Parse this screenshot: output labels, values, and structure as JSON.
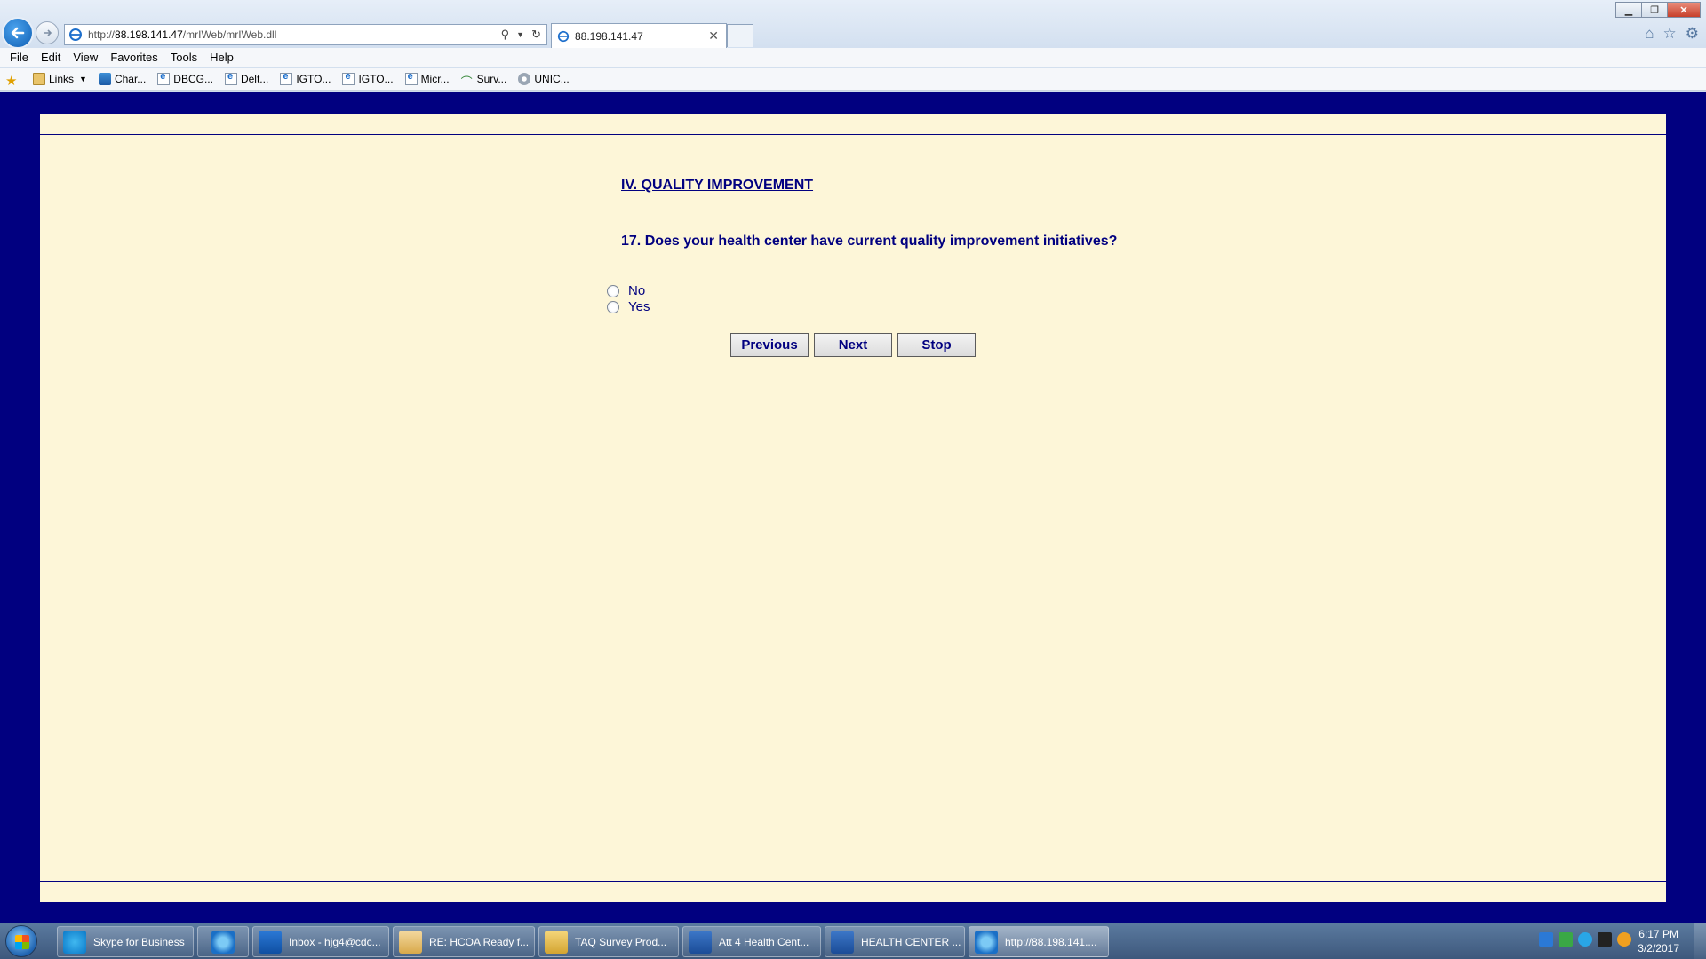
{
  "browser": {
    "address_prefix": "http://",
    "address_host": "88.198.141.47",
    "address_path": "/mrIWeb/mrIWeb.dll",
    "tab_title": "88.198.141.47"
  },
  "menu": [
    "File",
    "Edit",
    "View",
    "Favorites",
    "Tools",
    "Help"
  ],
  "favorites": {
    "links_label": "Links",
    "items": [
      "Char...",
      "DBCG...",
      "Delt...",
      "IGTO...",
      "IGTO...",
      "Micr...",
      "Surv...",
      "UNIC..."
    ]
  },
  "survey": {
    "section_title": "IV. QUALITY IMPROVEMENT",
    "question": "17. Does your health center have current quality improvement initiatives?",
    "options": [
      "No",
      "Yes"
    ],
    "buttons": {
      "previous": "Previous",
      "next": "Next",
      "stop": "Stop"
    }
  },
  "taskbar": {
    "items": [
      "Skype for Business",
      "",
      "Inbox - hjg4@cdc...",
      "RE: HCOA Ready f...",
      "TAQ Survey Prod...",
      "Att 4 Health Cent...",
      "HEALTH CENTER ...",
      "http://88.198.141...."
    ],
    "clock_time": "6:17 PM",
    "clock_date": "3/2/2017"
  },
  "colors": {
    "page_background": "#010080",
    "panel_background": "#fdf6d8",
    "text": "#010080"
  }
}
